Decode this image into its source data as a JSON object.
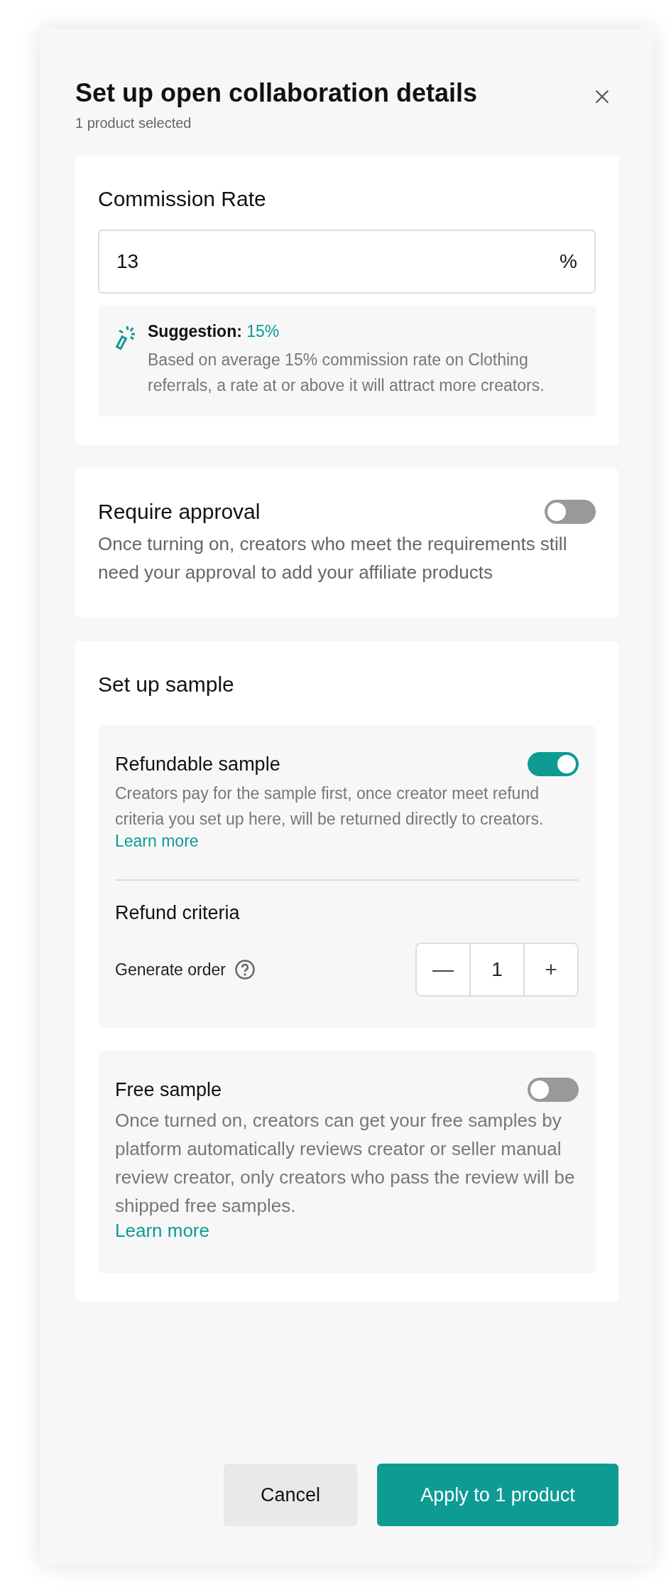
{
  "dialog": {
    "title": "Set up open collaboration details",
    "subtitle": "1 product selected"
  },
  "commission": {
    "heading": "Commission Rate",
    "value": "13",
    "unit": "%",
    "suggestion": {
      "label": "Suggestion:",
      "rate": "15%",
      "text": "Based on average 15% commission rate on Clothing referrals, a rate at or above it will attract more creators."
    }
  },
  "approval": {
    "heading": "Require approval",
    "on": false,
    "text": "Once turning on, creators who meet the requirements still need your approval to add your affiliate products"
  },
  "sample": {
    "heading": "Set up sample",
    "options": [
      {
        "kind": "refundable",
        "title": "Refundable sample",
        "on": true,
        "text": "Creators pay for the sample first, once creator meet refund criteria you set up here, will be returned directly to creators.",
        "link": "Learn more",
        "criteria": {
          "heading": "Refund criteria",
          "label": "Generate order",
          "minus": "—",
          "value": "1",
          "plus": "+"
        }
      },
      {
        "kind": "free",
        "title": "Free sample",
        "on": false,
        "text": "Once turned on, creators can get your free samples by platform automatically reviews creator or seller manual review creator, only creators who pass the review will be shipped free samples.",
        "link": "Learn more"
      }
    ]
  },
  "buttons": [
    {
      "label": "Cancel",
      "kind": "secondary"
    },
    {
      "label": "Apply to 1 product",
      "kind": "primary"
    }
  ]
}
